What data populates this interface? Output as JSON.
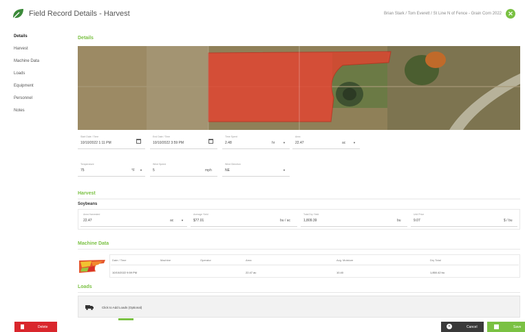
{
  "header": {
    "title": "Field Record Details - Harvest",
    "breadcrumb": "Brian Stark / Tom Everett / St Line N of Fence - Grain Corn 2022",
    "close_icon": "✕"
  },
  "sidebar": {
    "items": [
      {
        "label": "Details"
      },
      {
        "label": "Harvest"
      },
      {
        "label": "Machine Data"
      },
      {
        "label": "Loads"
      },
      {
        "label": "Equipment"
      },
      {
        "label": "Personnel"
      },
      {
        "label": "Notes"
      }
    ]
  },
  "details": {
    "section_title": "Details",
    "start": {
      "label": "Start Date / Time",
      "value": "10/10/2022 1:11 PM"
    },
    "end": {
      "label": "End Date / Time",
      "value": "10/10/2022 3:59 PM"
    },
    "time_spent": {
      "label": "Time Spent",
      "value": "2.48",
      "unit": "hr"
    },
    "area": {
      "label": "Area",
      "value": "22.47",
      "unit": "ac"
    },
    "temperature": {
      "label": "Temperature",
      "value": "75",
      "unit": "°F"
    },
    "wind_speed": {
      "label": "Wind Speed",
      "value": "5",
      "unit": "mph"
    },
    "wind_direction": {
      "label": "Wind Direction",
      "value": "NE"
    }
  },
  "harvest": {
    "section_title": "Harvest",
    "crop": "Soybeans",
    "area_harvested": {
      "label": "Area Harvested",
      "value": "22.47",
      "unit": "ac"
    },
    "average_yield": {
      "label": "Average Yield",
      "value": "$77.01",
      "unit": "bu / ac"
    },
    "total_dry_yield": {
      "label": "Total Dry Yield",
      "value": "1,809.39",
      "unit": "bu"
    },
    "unit_price": {
      "label": "Unit Price",
      "value": "9.07",
      "unit": "$ / bu"
    }
  },
  "machine_data": {
    "section_title": "Machine Data",
    "columns": [
      "Date / Time",
      "Machine",
      "Operator",
      "Area",
      "Avg. Moisture",
      "Dry Total"
    ],
    "rows": [
      {
        "datetime": "10/10/2022 9:59 PM",
        "machine": "",
        "operator": "",
        "area": "22.47 ac",
        "moisture": "10.40",
        "dry_total": "1,850.42 bu"
      }
    ]
  },
  "loads": {
    "section_title": "Loads",
    "add_text": "Click to Add Loads (Optional)"
  },
  "footer": {
    "delete_label": "Delete",
    "cancel_label": "Cancel",
    "save_label": "Save"
  },
  "colors": {
    "accent": "#7ac143",
    "danger": "#d9262c",
    "dark": "#3a3a3a",
    "field_overlay": "#e8412e"
  },
  "icons": {
    "logo": "leaf-logo-icon",
    "calendar": "calendar-icon",
    "caret": "chevron-down-icon",
    "truck": "truck-icon",
    "trash": "trash-icon",
    "cancel": "cancel-icon",
    "save": "save-icon"
  }
}
